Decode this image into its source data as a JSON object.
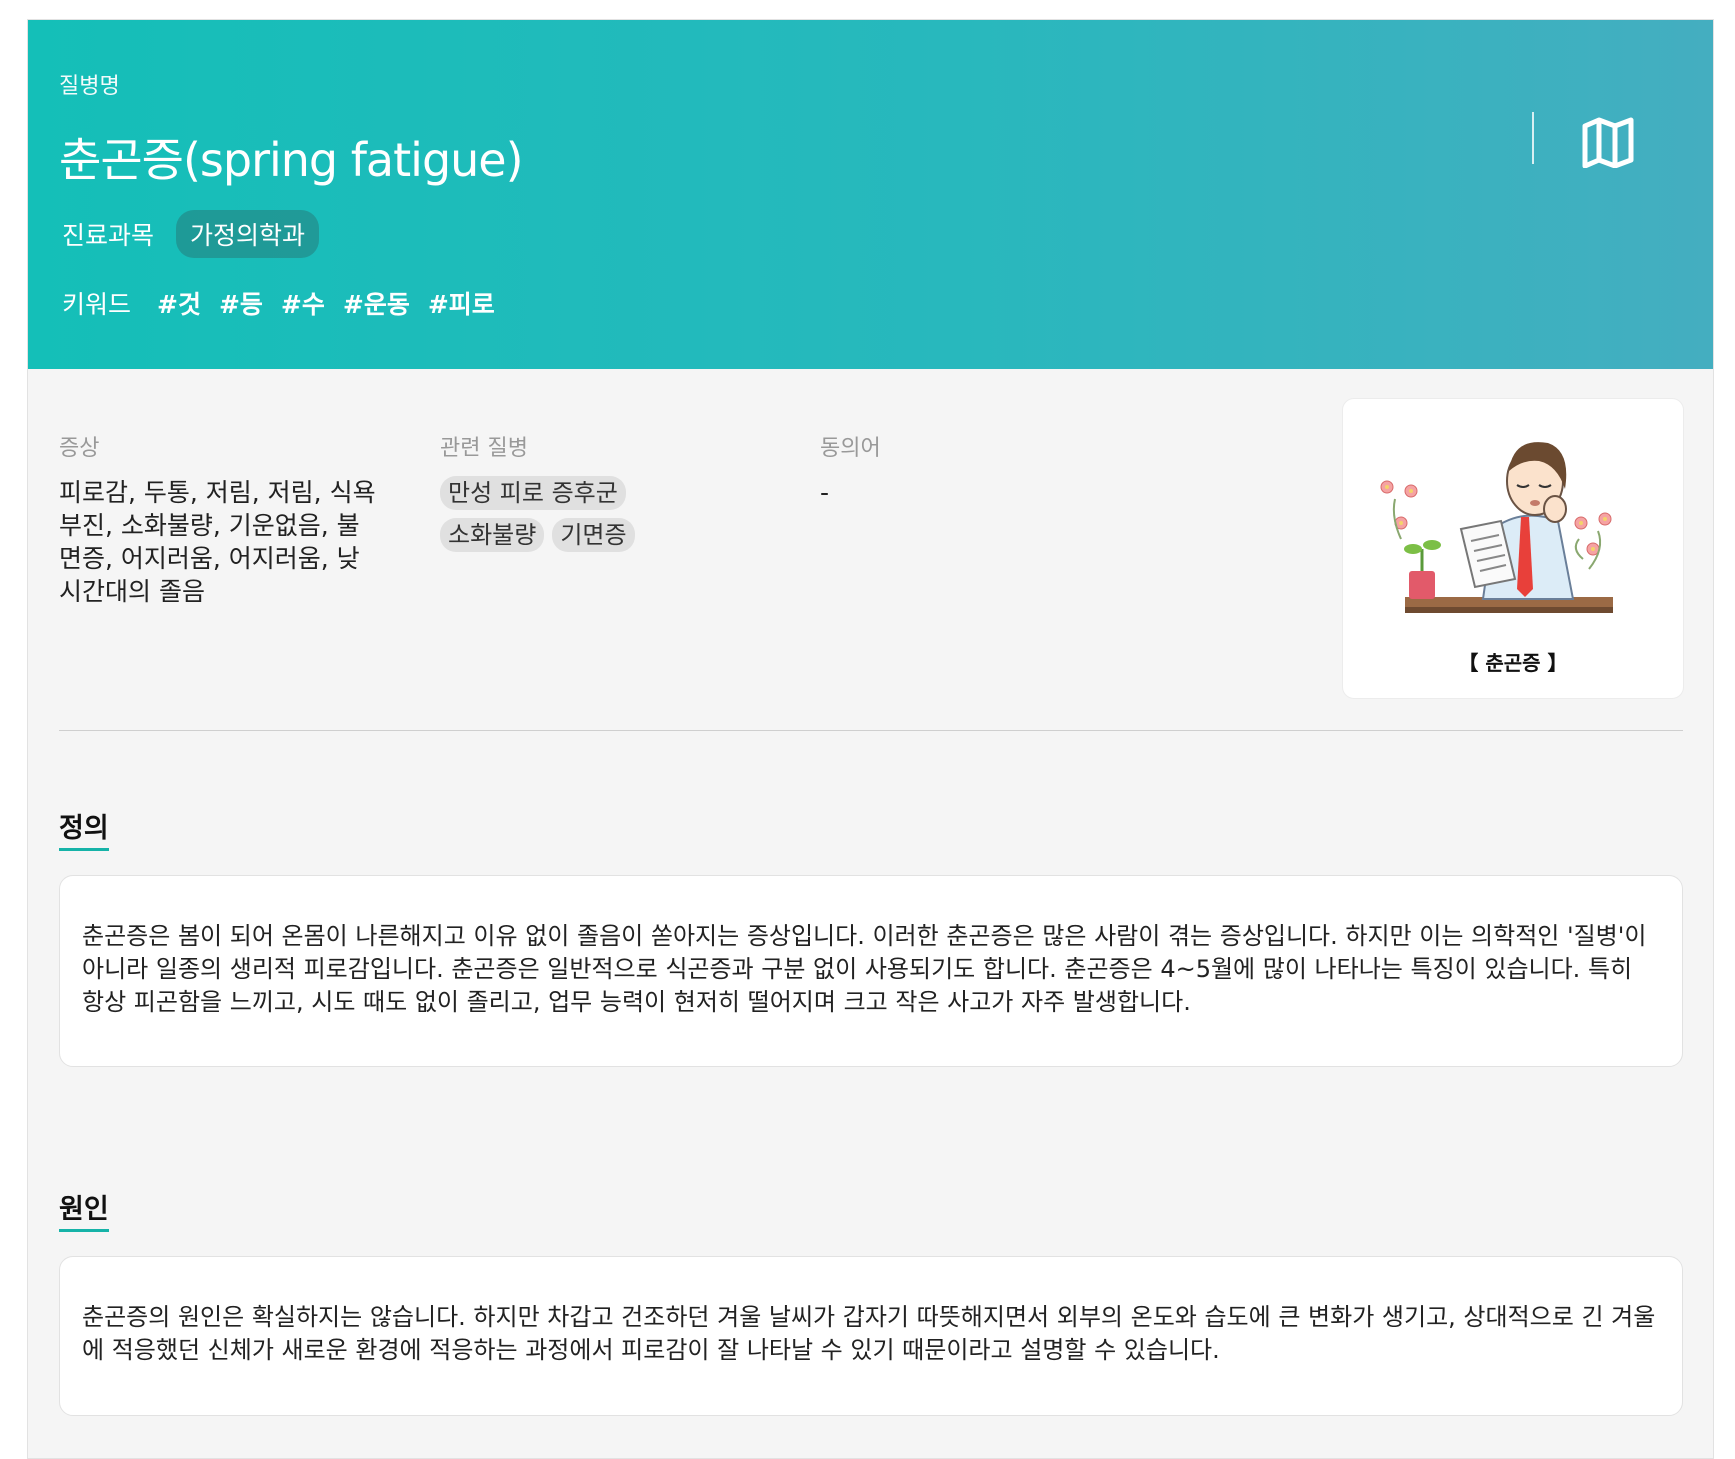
{
  "header": {
    "label": "질병명",
    "title": "춘곤증(spring fatigue)",
    "dept_label": "진료과목",
    "dept_value": "가정의학과",
    "keywords_label": "키워드",
    "keywords": [
      "#것",
      "#등",
      "#수",
      "#운동",
      "#피로"
    ],
    "map_icon": "map-icon"
  },
  "info": {
    "symptoms_label": "증상",
    "symptoms": "피로감, 두통, 저림, 저림, 식욕부진, 소화불량, 기운없음, 불면증, 어지러움, 어지러움, 낮 시간대의 졸음",
    "related_label": "관련 질병",
    "related": [
      "만성 피로 증후군",
      "소화불량",
      "기면증"
    ],
    "synonym_label": "동의어",
    "synonym": "-"
  },
  "figure": {
    "caption": "【 춘곤증 】"
  },
  "sections": [
    {
      "title": "정의",
      "body": "춘곤증은 봄이 되어 온몸이 나른해지고 이유 없이 졸음이 쏟아지는 증상입니다. 이러한 춘곤증은 많은 사람이 겪는 증상입니다. 하지만 이는 의학적인 '질병'이 아니라 일종의 생리적 피로감입니다. 춘곤증은 일반적으로 식곤증과 구분 없이 사용되기도 합니다. 춘곤증은 4~5월에 많이 나타나는 특징이 있습니다. 특히 항상 피곤함을 느끼고, 시도 때도 없이 졸리고, 업무 능력이 현저히 떨어지며 크고 작은 사고가 자주 발생합니다."
    },
    {
      "title": "원인",
      "body": "춘곤증의 원인은 확실하지는 않습니다. 하지만 차갑고 건조하던 겨울 날씨가 갑자기 따뜻해지면서 외부의 온도와 습도에 큰 변화가 생기고, 상대적으로 긴 겨울에 적응했던 신체가 새로운 환경에 적응하는 과정에서 피로감이 잘 나타날 수 있기 때문이라고 설명할 수 있습니다."
    }
  ]
}
